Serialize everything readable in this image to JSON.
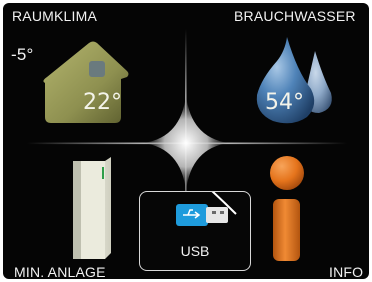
{
  "labels": {
    "top_left": "RAUMKLIMA",
    "top_right": "BRAUCHWASSER",
    "bottom_left": "MIN. ANLAGE",
    "bottom_right": "INFO"
  },
  "outdoor_temp": "-5°",
  "indoor_temp": "22°",
  "hot_water_temp": "54°",
  "usb_label": "USB",
  "colors": {
    "background": "#050505",
    "house": "#8e9050",
    "drop": "#4f83b8",
    "info": "#e5741c",
    "text": "#f2f2f2"
  },
  "icons": {
    "room": "house-icon",
    "hot_water": "water-drop-icon",
    "system": "heat-pump-icon",
    "usb": "usb-stick-icon",
    "info": "info-icon"
  }
}
